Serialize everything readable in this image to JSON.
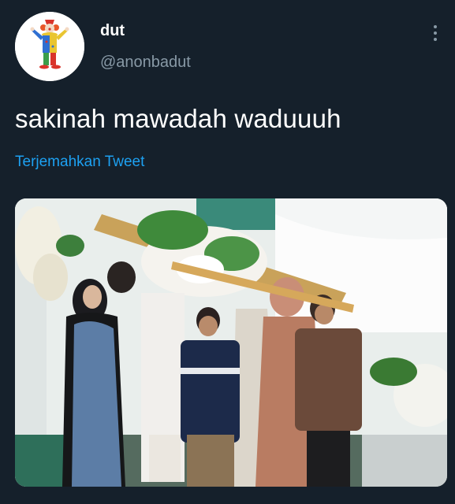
{
  "tweet": {
    "author": {
      "display_name": "dut",
      "handle": "@anonbadut",
      "avatar_icon": "clown-avatar-icon"
    },
    "text": "sakinah mawadah waduuuh",
    "translate_label": "Terjemahkan Tweet",
    "media": {
      "type": "photo",
      "subject_icon": "wedding-photo"
    },
    "more_icon": "more-vertical-icon"
  },
  "colors": {
    "background": "#15202b",
    "primary_text": "#ffffff",
    "secondary_text": "#8899a6",
    "link": "#1da1f2"
  }
}
